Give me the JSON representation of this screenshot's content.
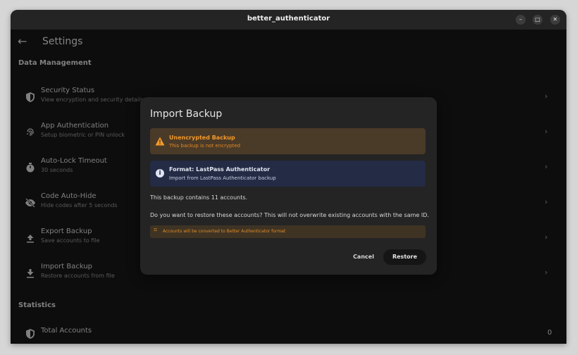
{
  "window": {
    "title": "better_authenticator"
  },
  "appbar": {
    "title": "Settings"
  },
  "sections": {
    "data_management": "Data Management",
    "statistics": "Statistics"
  },
  "rows": [
    {
      "title": "Security Status",
      "subtitle": "View encryption and security details",
      "icon": "shield-icon"
    },
    {
      "title": "App Authentication",
      "subtitle": "Setup biometric or PIN unlock",
      "icon": "fingerprint-icon"
    },
    {
      "title": "Auto-Lock Timeout",
      "subtitle": "30 seconds",
      "icon": "timer-icon"
    },
    {
      "title": "Code Auto-Hide",
      "subtitle": "Hide codes after 5 seconds",
      "icon": "eye-off-icon"
    },
    {
      "title": "Export Backup",
      "subtitle": "Save accounts to file",
      "icon": "upload-icon"
    },
    {
      "title": "Import Backup",
      "subtitle": "Restore accounts from file",
      "icon": "download-icon"
    }
  ],
  "stats": {
    "total_accounts_label": "Total Accounts",
    "total_accounts_value": "0"
  },
  "dialog": {
    "title": "Import Backup",
    "warning": {
      "title": "Unencrypted Backup",
      "subtitle": "This backup is not encrypted"
    },
    "info": {
      "title": "Format: LastPass Authenticator",
      "subtitle": "Import from LastPass Authenticator backup"
    },
    "count_text": "This backup contains 11 accounts.",
    "question": "Do you want to restore these accounts? This will not overwrite existing accounts with the same ID.",
    "note": "Accounts will be converted to Better Authenticator format",
    "cancel": "Cancel",
    "restore": "Restore"
  },
  "colors": {
    "background": "#161616",
    "warning_accent": "#f49a2a",
    "warning_bg": "#4a3a28",
    "info_bg": "#232b45",
    "restore_bg": "#151515"
  }
}
